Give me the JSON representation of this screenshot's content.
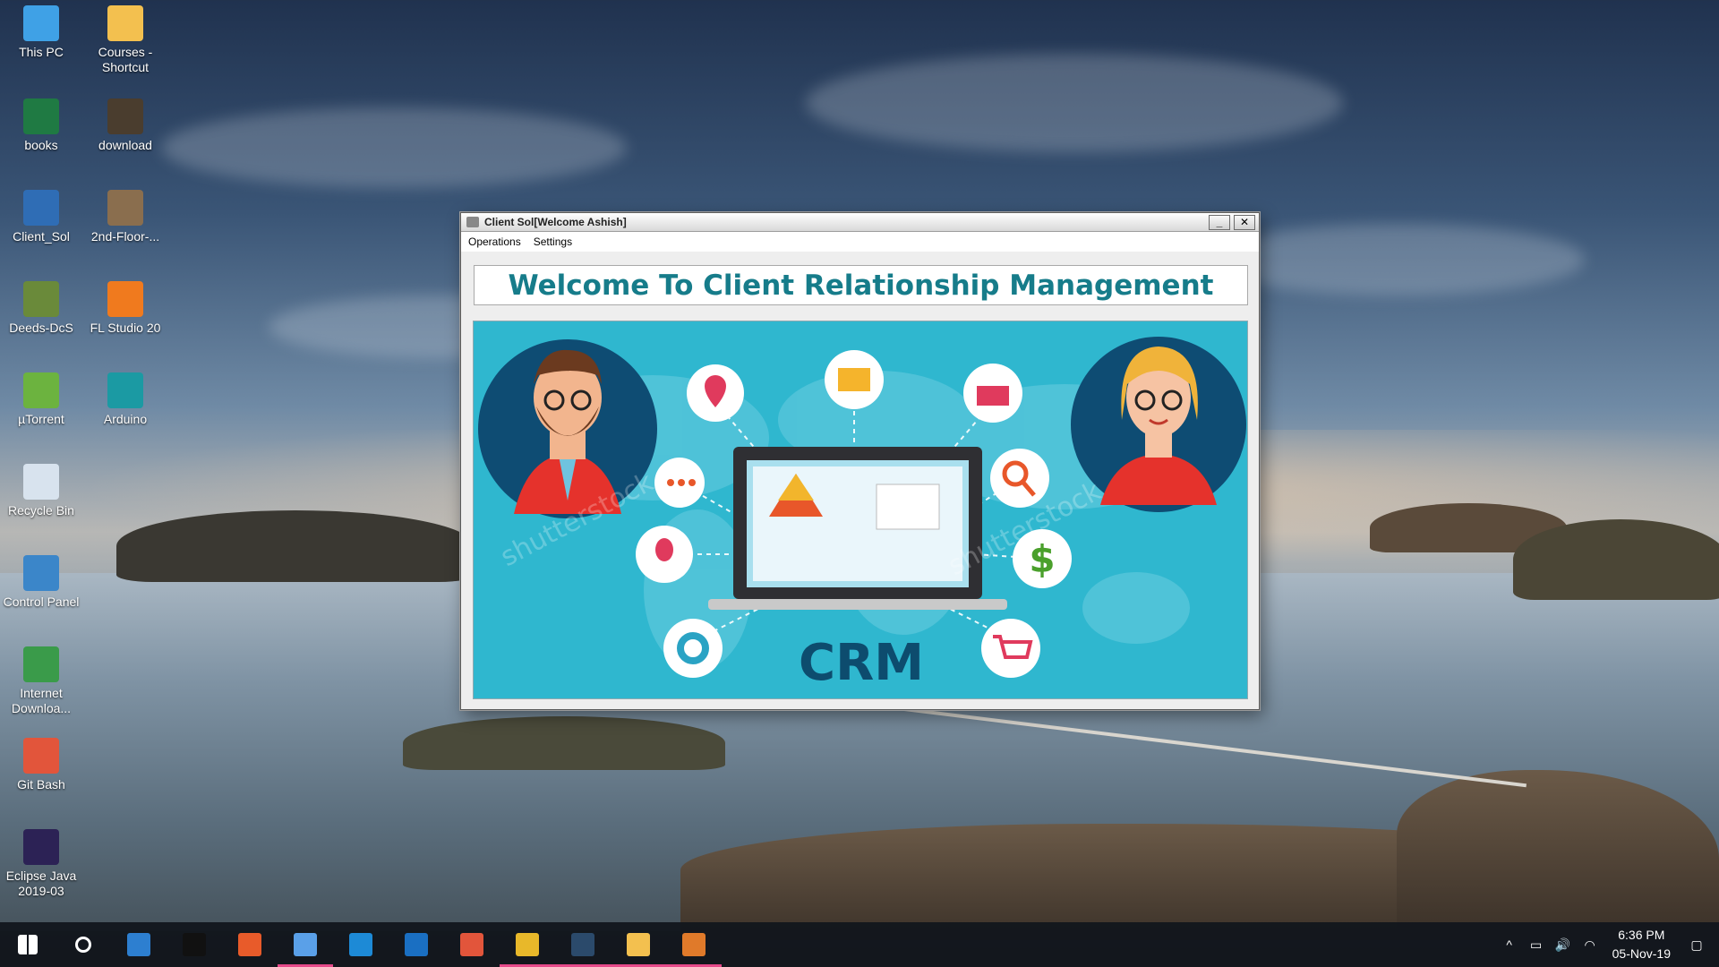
{
  "desktop": {
    "icons": [
      {
        "label": "This PC",
        "icon": "computer-icon",
        "color": "#3fa1e6"
      },
      {
        "label": "Courses - Shortcut",
        "icon": "folder-icon",
        "color": "#f3c04f"
      },
      {
        "label": "books",
        "icon": "excel-icon",
        "color": "#1f7a43"
      },
      {
        "label": "download",
        "icon": "image-icon",
        "color": "#4a3d2e"
      },
      {
        "label": "Client_Sol",
        "icon": "java-app-icon",
        "color": "#2f6db5"
      },
      {
        "label": "2nd-Floor-...",
        "icon": "image-icon",
        "color": "#8a6e4e"
      },
      {
        "label": "Deeds-DcS",
        "icon": "circuit-icon",
        "color": "#6a8a3a"
      },
      {
        "label": "FL Studio 20",
        "icon": "fl-studio-icon",
        "color": "#f07a1e"
      },
      {
        "label": "µTorrent",
        "icon": "utorrent-icon",
        "color": "#6cb33f"
      },
      {
        "label": "Arduino",
        "icon": "arduino-icon",
        "color": "#1b9aa3"
      },
      {
        "label": "Recycle Bin",
        "icon": "recycle-bin-icon",
        "color": "#d8e3ee"
      },
      {
        "label": "Control Panel",
        "icon": "control-panel-icon",
        "color": "#3b86c9"
      },
      {
        "label": "Internet Downloa...",
        "icon": "idm-icon",
        "color": "#3a9b4a"
      },
      {
        "label": "Git Bash",
        "icon": "git-icon",
        "color": "#e2553b"
      },
      {
        "label": "Eclipse Java 2019-03",
        "icon": "eclipse-icon",
        "color": "#2c2255"
      }
    ]
  },
  "window": {
    "title": "Client Sol[Welcome Ashish]",
    "minimize_label": "_",
    "close_label": "✕",
    "menu": [
      "Operations",
      "Settings"
    ],
    "banner": "Welcome To Client Relationship Management",
    "crm_image": {
      "center_text": "CRM",
      "watermark": "shutterstock",
      "bg_color": "#2fb7cf",
      "accent": "#0d4c6e"
    }
  },
  "taskbar": {
    "items": [
      {
        "name": "start-button",
        "icon": "windows-logo-icon",
        "active": false
      },
      {
        "name": "search-button",
        "icon": "search-icon",
        "active": false
      },
      {
        "name": "taskbar-store",
        "icon": "store-icon",
        "active": false
      },
      {
        "name": "taskbar-terminal",
        "icon": "terminal-icon",
        "active": false
      },
      {
        "name": "taskbar-windows-app",
        "icon": "tiles-icon",
        "active": false
      },
      {
        "name": "taskbar-virtualbox",
        "icon": "cube-icon",
        "active": true
      },
      {
        "name": "taskbar-vscode",
        "icon": "vscode-icon",
        "active": false
      },
      {
        "name": "taskbar-edge",
        "icon": "edge-icon",
        "active": false
      },
      {
        "name": "taskbar-git",
        "icon": "git-icon",
        "active": false
      },
      {
        "name": "taskbar-chrome",
        "icon": "chrome-icon",
        "active": true
      },
      {
        "name": "taskbar-mysql",
        "icon": "mysql-icon",
        "active": true
      },
      {
        "name": "taskbar-file-explorer",
        "icon": "folder-icon",
        "active": true
      },
      {
        "name": "taskbar-java",
        "icon": "java-icon",
        "active": true
      }
    ],
    "time": "6:36 PM",
    "date": "05-Nov-19"
  }
}
